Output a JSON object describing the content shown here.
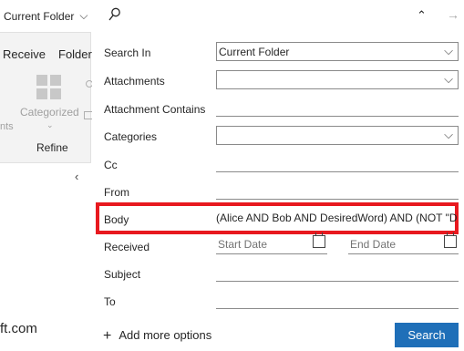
{
  "left": {
    "folder_scope": "Current Folder",
    "tabs": [
      "Receive",
      "Folder"
    ],
    "categorized_label": "Categorized",
    "nts_fragment": "nts",
    "refine_label": "Refine",
    "domain_fragment": "ft.com"
  },
  "search_panel": {
    "fields": {
      "search_in": {
        "label": "Search In",
        "value": "Current Folder"
      },
      "attachments": {
        "label": "Attachments",
        "value": ""
      },
      "attachment_contains": {
        "label": "Attachment Contains",
        "value": ""
      },
      "categories": {
        "label": "Categories",
        "value": ""
      },
      "cc": {
        "label": "Cc",
        "value": ""
      },
      "from": {
        "label": "From",
        "value": ""
      },
      "body": {
        "label": "Body",
        "value": "(Alice AND Bob AND DesiredWord) AND (NOT \"D"
      },
      "received": {
        "label": "Received",
        "start_placeholder": "Start Date",
        "end_placeholder": "End Date"
      },
      "subject": {
        "label": "Subject",
        "value": ""
      },
      "to": {
        "label": "To",
        "value": ""
      }
    },
    "add_more_options": "Add more options",
    "search_button": "Search"
  },
  "colors": {
    "highlight": "#e8191f",
    "search_button": "#1f6fb8"
  },
  "icons": [
    "search-icon",
    "chevron-up-icon",
    "arrow-right-icon",
    "chevron-down-icon",
    "calendar-icon",
    "plus-icon",
    "collapse-left-icon"
  ]
}
